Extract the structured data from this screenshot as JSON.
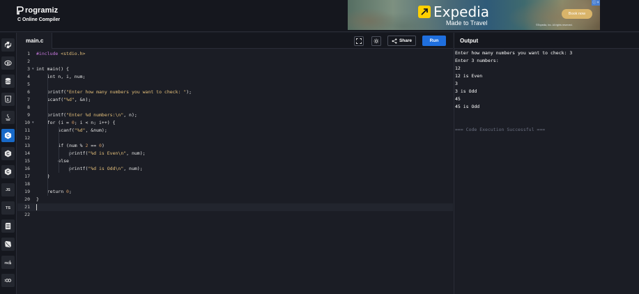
{
  "header": {
    "brand": "rogramiz",
    "subtitle": "C Online Compiler"
  },
  "ad": {
    "brand": "Expedia",
    "tagline": "Made to Travel",
    "cta": "Book now",
    "badge": "ⓘ ×",
    "fine_print": "©Expedia, Inc. All rights reserved."
  },
  "sidebar": {
    "items": [
      {
        "icon": "python-icon"
      },
      {
        "icon": "r-lang-icon"
      },
      {
        "icon": "sql-icon"
      },
      {
        "icon": "html5-icon"
      },
      {
        "icon": "java-icon"
      },
      {
        "icon": "c-lang-icon",
        "active": true
      },
      {
        "icon": "cpp-icon"
      },
      {
        "icon": "csharp-icon"
      },
      {
        "icon": "js-icon",
        "label": "JS"
      },
      {
        "icon": "ts-icon",
        "label": "TS"
      },
      {
        "icon": "stack-icon"
      },
      {
        "icon": "ruby-icon"
      },
      {
        "icon": "rust-icon"
      },
      {
        "icon": "go-icon"
      }
    ]
  },
  "editor": {
    "file_tab": "main.c",
    "share_label": "Share",
    "run_label": "Run",
    "lines": [
      "#include <stdio.h>",
      "",
      "int main() {",
      "    int n, i, num;",
      "",
      "    printf(\"Enter how many numbers you want to check: \");",
      "    scanf(\"%d\", &n);",
      "",
      "    printf(\"Enter %d numbers:\\n\", n);",
      "    for (i = 0; i < n; i++) {",
      "        scanf(\"%d\", &num);",
      "",
      "        if (num % 2 == 0)",
      "            printf(\"%d is Even\\n\", num);",
      "        else",
      "            printf(\"%d is Odd\\n\", num);",
      "    }",
      "",
      "    return 0;",
      "}",
      "",
      ""
    ],
    "line_numbers": [
      "1",
      "2",
      "3",
      "4",
      "5",
      "6",
      "7",
      "8",
      "9",
      "10",
      "11",
      "12",
      "13",
      "14",
      "15",
      "16",
      "17",
      "18",
      "19",
      "20",
      "21",
      "22"
    ],
    "current_line": 21
  },
  "output": {
    "title": "Output",
    "lines": [
      "Enter how many numbers you want to check: 3",
      "Enter 3 numbers:",
      "12",
      "12 is Even",
      "3",
      "3 is Odd",
      "45",
      "45 is Odd",
      "",
      "",
      "=== Code Execution Successful ==="
    ]
  },
  "colors": {
    "accent": "#1f6fde",
    "active_rail": "#1869c7",
    "background": "#1b1d25",
    "keyword": "#e8e8e8",
    "string": "#e5c07b",
    "include": "#c678dd"
  }
}
